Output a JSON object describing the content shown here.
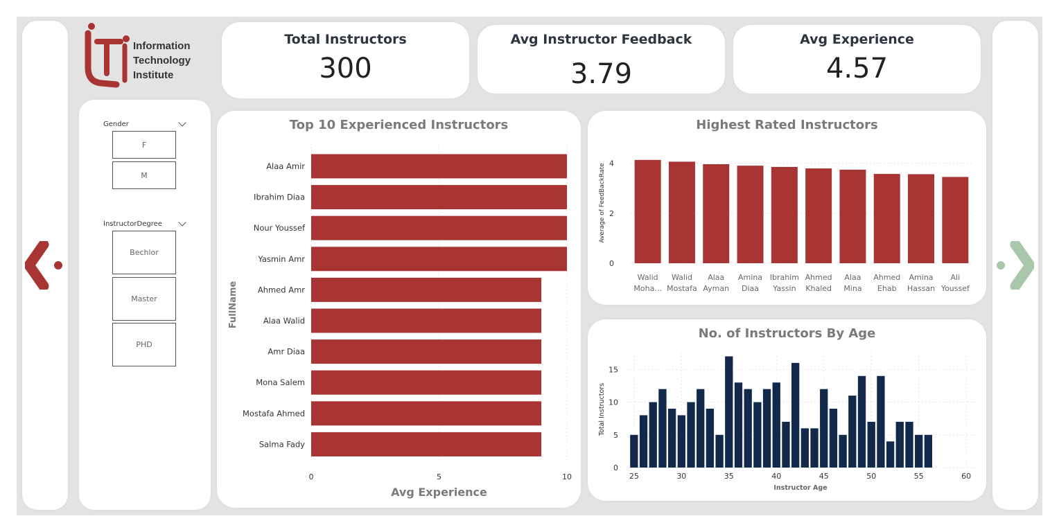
{
  "logo": {
    "text_lines": [
      "Information",
      "Technology",
      "Institute"
    ]
  },
  "kpis": [
    {
      "title": "Total Instructors",
      "value": "300"
    },
    {
      "title": "Avg Instructor Feedback",
      "value": "3.79"
    },
    {
      "title": "Avg Experience",
      "value": "4.57"
    }
  ],
  "filters": {
    "gender": {
      "title": "Gender",
      "options": [
        "F",
        "M"
      ]
    },
    "degree": {
      "title": "InstructorDegree",
      "options": [
        "Bechlor",
        "Master",
        "PHD"
      ]
    }
  },
  "nav": {
    "back_icon": "back-arrow-icon",
    "next_icon": "forward-arrow-icon",
    "back_color": "#a83434",
    "next_color": "#a9c7ab"
  },
  "colors": {
    "bar_red": "#a83434",
    "bar_navy": "#13294b"
  },
  "chart_data": [
    {
      "type": "bar",
      "orientation": "horizontal",
      "title": "Top 10 Experienced Instructors",
      "xlabel": "Avg Experience",
      "ylabel": "FullName",
      "categories": [
        "Alaa Amir",
        "Ibrahim Diaa",
        "Nour Youssef",
        "Yasmin Amr",
        "Ahmed Amr",
        "Alaa Walid",
        "Amr Diaa",
        "Mona Salem",
        "Mostafa Ahmed",
        "Salma Fady"
      ],
      "values": [
        10,
        10,
        10,
        10,
        9,
        9,
        9,
        9,
        9,
        9
      ],
      "xlim": [
        0,
        10
      ],
      "xticks": [
        "0",
        "5",
        "10"
      ],
      "grid": true
    },
    {
      "type": "bar",
      "title": "Highest Rated Instructors",
      "ylabel": "Average of FeedBackRate",
      "categories": [
        [
          "Walid",
          "Moha..."
        ],
        [
          "Walid",
          "Mostafa"
        ],
        [
          "Alaa",
          "Ayman"
        ],
        [
          "Amina",
          "Diaa"
        ],
        [
          "Ibrahim",
          "Yassin"
        ],
        [
          "Ahmed",
          "Khaled"
        ],
        [
          "Alaa",
          "Mina"
        ],
        [
          "Ahmed",
          "Ehab"
        ],
        [
          "Amina",
          "Hassan"
        ],
        [
          "Ali",
          "Youssef"
        ]
      ],
      "values": [
        4.13,
        4.06,
        3.96,
        3.9,
        3.85,
        3.79,
        3.74,
        3.57,
        3.56,
        3.45
      ],
      "ylim": [
        0,
        4.5
      ],
      "yticks": [
        "0",
        "2",
        "4"
      ],
      "grid": true
    },
    {
      "type": "bar",
      "title": "No. of Instructors By Age",
      "xlabel": "Instructor Age",
      "ylabel": "Total Instructors",
      "x": [
        25,
        26,
        27,
        28,
        29,
        30,
        31,
        32,
        33,
        34,
        35,
        36,
        37,
        38,
        39,
        40,
        41,
        42,
        43,
        44,
        45,
        46,
        47,
        48,
        49,
        50,
        51,
        52,
        53,
        54,
        55,
        56
      ],
      "values": [
        5,
        8,
        10,
        12,
        9,
        8,
        10,
        12,
        9,
        5,
        17,
        13,
        12,
        10,
        12,
        13,
        7,
        16,
        6,
        6,
        12,
        9,
        5,
        11,
        14,
        7,
        14,
        4,
        7,
        7,
        5,
        5
      ],
      "xlim": [
        24.5,
        60.5
      ],
      "ylim": [
        0,
        18
      ],
      "xticks": [
        "25",
        "30",
        "35",
        "40",
        "45",
        "50",
        "55",
        "60"
      ],
      "yticks": [
        "0",
        "5",
        "10",
        "15"
      ],
      "grid": true
    }
  ]
}
